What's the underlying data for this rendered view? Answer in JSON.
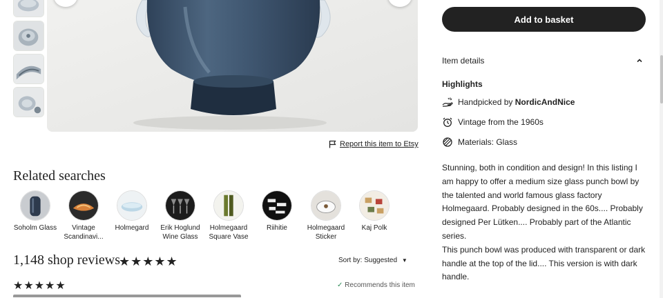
{
  "actions": {
    "add_to_basket": "Add to basket"
  },
  "report": {
    "label": "Report this item to Etsy"
  },
  "details": {
    "header": "Item details",
    "highlights_title": "Highlights",
    "handpicked_prefix": "Handpicked by",
    "shop_name": "NordicAndNice",
    "vintage": "Vintage from the 1960s",
    "materials": "Materials: Glass",
    "description": [
      "Stunning, both in condition and design! In this listing I am happy to offer a medium size glass punch bowl by the talented and world famous glass factory Holmegaard. Probably designed in the 60s.... Probably designed Per Lütken.... Probably part of the Atlantic series.",
      "This punch bowl was produced with transparent or dark handle at the top of the lid.... This version is with dark handle."
    ]
  },
  "related": {
    "title": "Related searches",
    "items": [
      {
        "label": "Soholm Glass"
      },
      {
        "label": "Vintage Scandinavi..."
      },
      {
        "label": "Holmegard"
      },
      {
        "label": "Erik Hoglund Wine Glass"
      },
      {
        "label": "Holmegaard Square Vase"
      },
      {
        "label": "Riihitie"
      },
      {
        "label": "Holmegaard Sticker"
      },
      {
        "label": "Kaj Polk"
      }
    ]
  },
  "reviews": {
    "title": "1,148 shop reviews",
    "stars": "★★★★★",
    "sort_label": "Sort by: Suggested",
    "review_stars": "★★★★★",
    "recommends": "Recommends this item"
  },
  "icons": {
    "handpicked": "hand-icon",
    "vintage": "alarm-clock-icon",
    "materials": "materials-icon",
    "report": "flag-icon",
    "collapse": "chevron-up-icon",
    "sort": "caret-down-icon"
  },
  "colors": {
    "button": "#222222",
    "accent_check": "#2e8b57",
    "glass": "#3f5670"
  }
}
